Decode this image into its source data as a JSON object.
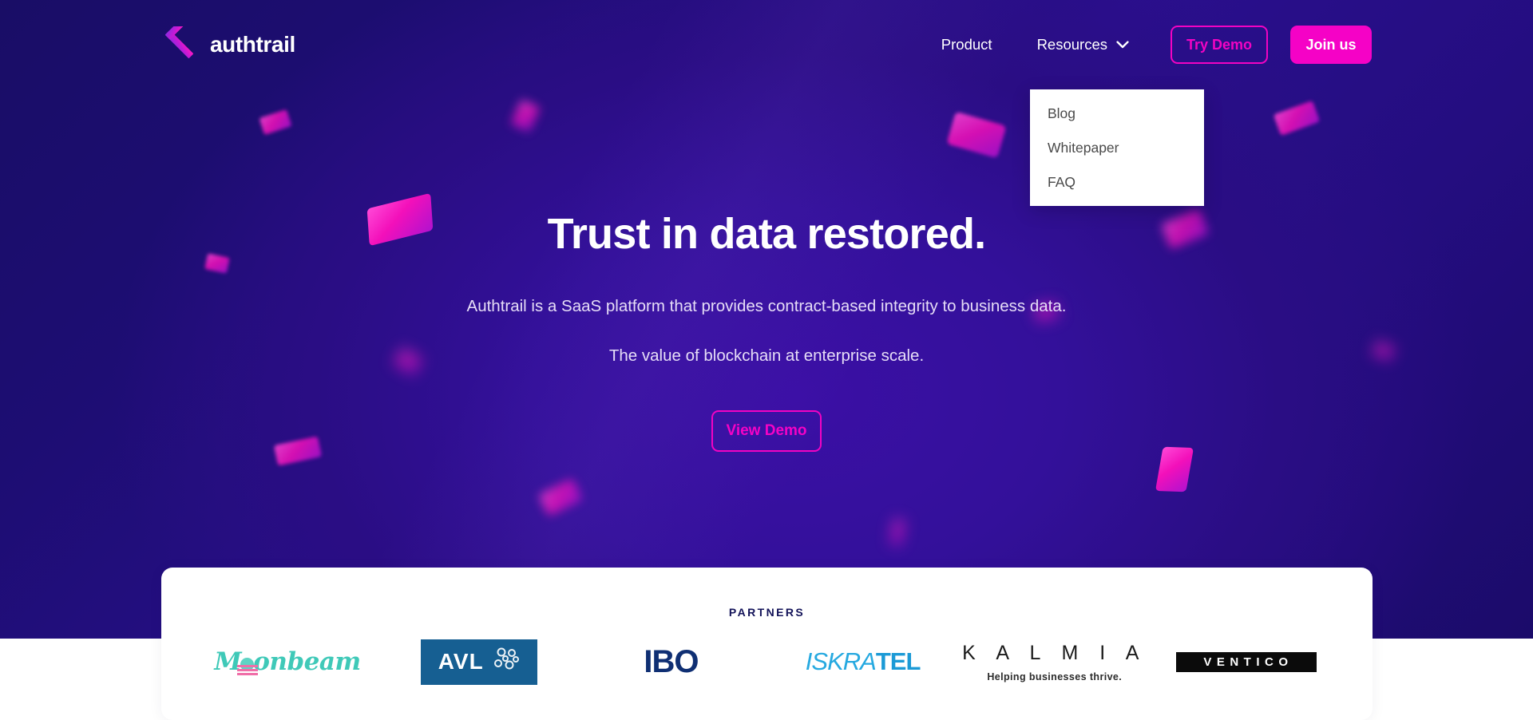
{
  "brand": {
    "name": "authtrail",
    "logo_icon": "authtrail-mark-icon",
    "accent": "#f502c6",
    "accent_outline": "#f203c3"
  },
  "nav": {
    "links": [
      {
        "label": "Product",
        "name": "product"
      },
      {
        "label": "Resources",
        "name": "resources",
        "has_dropdown": true,
        "icon": "chevron-down-icon"
      }
    ],
    "try_demo_label": "Try Demo",
    "join_us_label": "Join us",
    "dropdown": {
      "open": true,
      "items": [
        {
          "label": "Blog"
        },
        {
          "label": "Whitepaper"
        },
        {
          "label": "FAQ"
        }
      ]
    }
  },
  "hero": {
    "title": "Trust in data restored.",
    "subtitle_1": "Authtrail is a SaaS platform that provides contract-based integrity to business data.",
    "subtitle_2": "The value of blockchain at enterprise scale.",
    "cta_label": "View Demo",
    "background": {
      "dark": "#190d66",
      "mid": "#2a0f8d",
      "shape_color": "#f310ba"
    }
  },
  "partners": {
    "title": "PARTNERS",
    "logos": [
      {
        "name": "moonbeam",
        "text": "M",
        "text_tail": "onbeam",
        "color": "#3fc9b8"
      },
      {
        "name": "avl",
        "text": "AVL",
        "color": "#165f92"
      },
      {
        "name": "ibo",
        "text": "IBO",
        "color": "#0f2f73"
      },
      {
        "name": "iskratel",
        "text": "ISKRA",
        "text_tail": "TEL",
        "color": "#26a9e0"
      },
      {
        "name": "kalmia",
        "text": "K A L M I A",
        "tagline": "Helping businesses thrive.",
        "color": "#1b1b1b"
      },
      {
        "name": "ventico",
        "text": "VENTICO",
        "color": "#0b0b0b"
      }
    ]
  }
}
